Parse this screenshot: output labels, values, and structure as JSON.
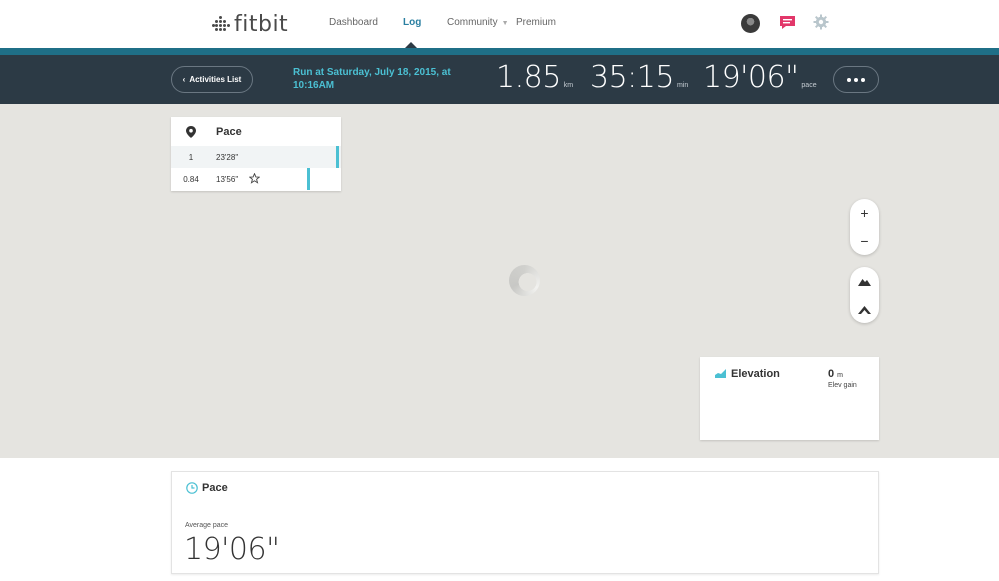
{
  "brand": {
    "logo_text": "fitbit"
  },
  "nav": {
    "items": [
      {
        "label": "Dashboard"
      },
      {
        "label": "Log"
      },
      {
        "label": "Community"
      },
      {
        "label": "Premium"
      }
    ],
    "active": "Log"
  },
  "icons": {
    "avatar": "avatar",
    "messages": "chat-bubble-icon",
    "settings": "gear-icon",
    "location": "map-pin-icon",
    "favorite": "star-icon",
    "elevation": "elevation-chart-icon",
    "pace": "clock-icon"
  },
  "header": {
    "back_label": "Activities List",
    "activity_title": "Run at Saturday, July 18, 2015, at 10:16AM",
    "stats": [
      {
        "value": "1.85",
        "unit": "km"
      },
      {
        "value": "35:15",
        "unit": "min"
      },
      {
        "value": "19'06\"",
        "unit": "pace"
      }
    ]
  },
  "pace_panel": {
    "title": "Pace",
    "splits": [
      {
        "split": "1",
        "time": "23'28\"",
        "relative": 1.0
      },
      {
        "split": "0.84",
        "time": "13'56\"",
        "relative": 0.59,
        "starred": true
      }
    ]
  },
  "map_controls": {
    "zoom_in": "+",
    "zoom_out": "−"
  },
  "elevation": {
    "title": "Elevation",
    "value": "0",
    "unit": "m",
    "label": "Elev gain"
  },
  "pace_card": {
    "title": "Pace",
    "label": "Average pace",
    "value": "19'06\""
  },
  "colors": {
    "accent": "#4bc0d3",
    "header_bg": "#2c3a45",
    "strip": "#1f6f87",
    "map_bg": "#e5e4e0",
    "message_icon": "#e2376a",
    "nav_active": "#2a7fa1"
  }
}
